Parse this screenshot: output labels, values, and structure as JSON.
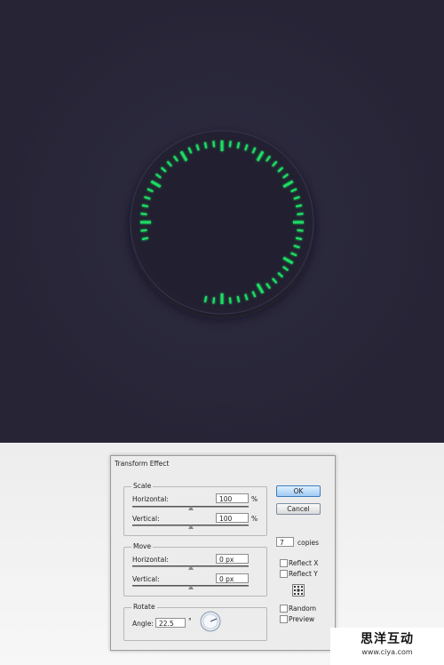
{
  "canvas": {
    "background": "#262435",
    "tick_color": "#1fde62"
  },
  "dialog": {
    "title": "Transform Effect",
    "scale": {
      "label": "Scale",
      "horizontal_label": "Horizontal:",
      "horizontal_value": "100",
      "horizontal_unit": "%",
      "vertical_label": "Vertical:",
      "vertical_value": "100",
      "vertical_unit": "%"
    },
    "move": {
      "label": "Move",
      "horizontal_label": "Horizontal:",
      "horizontal_value": "0 px",
      "vertical_label": "Vertical:",
      "vertical_value": "0 px"
    },
    "rotate": {
      "label": "Rotate",
      "angle_label": "Angle:",
      "angle_value": "22.5",
      "angle_unit": "°"
    },
    "ok_label": "OK",
    "cancel_label": "Cancel",
    "copies_value": "7",
    "copies_label": "copies",
    "reflect_x_label": "Reflect X",
    "reflect_y_label": "Reflect Y",
    "random_label": "Random",
    "preview_label": "Preview"
  },
  "watermark": {
    "title": "思洋互动",
    "url": "www.ciya.com"
  }
}
